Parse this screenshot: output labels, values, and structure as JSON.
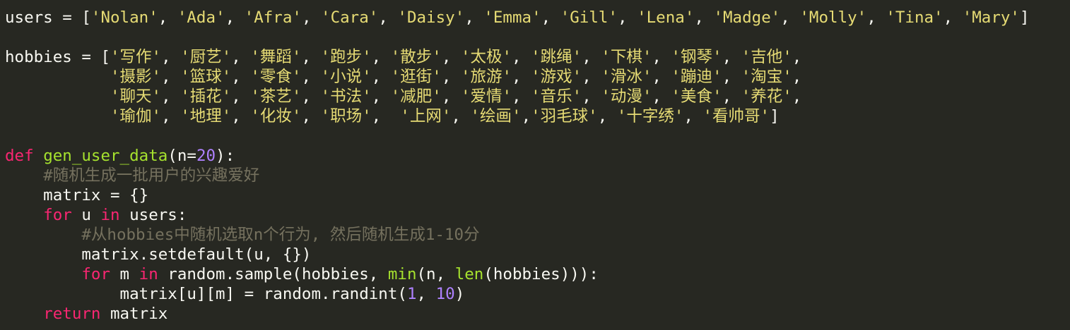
{
  "editor": {
    "theme": {
      "background": "#272822",
      "foreground": "#f8f8f2",
      "keyword": "#f92672",
      "function": "#a6e22e",
      "string": "#e6db74",
      "number": "#ae81ff",
      "comment": "#75715e"
    },
    "code_lines": [
      {
        "tokens": [
          {
            "t": "users = [",
            "c": "pl"
          },
          {
            "t": "'Nolan'",
            "c": "str"
          },
          {
            "t": ", ",
            "c": "pl"
          },
          {
            "t": "'Ada'",
            "c": "str"
          },
          {
            "t": ", ",
            "c": "pl"
          },
          {
            "t": "'Afra'",
            "c": "str"
          },
          {
            "t": ", ",
            "c": "pl"
          },
          {
            "t": "'Cara'",
            "c": "str"
          },
          {
            "t": ", ",
            "c": "pl"
          },
          {
            "t": "'Daisy'",
            "c": "str"
          },
          {
            "t": ", ",
            "c": "pl"
          },
          {
            "t": "'Emma'",
            "c": "str"
          },
          {
            "t": ", ",
            "c": "pl"
          },
          {
            "t": "'Gill'",
            "c": "str"
          },
          {
            "t": ", ",
            "c": "pl"
          },
          {
            "t": "'Lena'",
            "c": "str"
          },
          {
            "t": ", ",
            "c": "pl"
          },
          {
            "t": "'Madge'",
            "c": "str"
          },
          {
            "t": ", ",
            "c": "pl"
          },
          {
            "t": "'Molly'",
            "c": "str"
          },
          {
            "t": ", ",
            "c": "pl"
          },
          {
            "t": "'Tina'",
            "c": "str"
          },
          {
            "t": ", ",
            "c": "pl"
          },
          {
            "t": "'Mary'",
            "c": "str"
          },
          {
            "t": "]",
            "c": "pl"
          }
        ]
      },
      {
        "tokens": []
      },
      {
        "tokens": [
          {
            "t": "hobbies = [",
            "c": "pl"
          },
          {
            "t": "'写作'",
            "c": "str"
          },
          {
            "t": ", ",
            "c": "pl"
          },
          {
            "t": "'厨艺'",
            "c": "str"
          },
          {
            "t": ", ",
            "c": "pl"
          },
          {
            "t": "'舞蹈'",
            "c": "str"
          },
          {
            "t": ", ",
            "c": "pl"
          },
          {
            "t": "'跑步'",
            "c": "str"
          },
          {
            "t": ", ",
            "c": "pl"
          },
          {
            "t": "'散步'",
            "c": "str"
          },
          {
            "t": ", ",
            "c": "pl"
          },
          {
            "t": "'太极'",
            "c": "str"
          },
          {
            "t": ", ",
            "c": "pl"
          },
          {
            "t": "'跳绳'",
            "c": "str"
          },
          {
            "t": ", ",
            "c": "pl"
          },
          {
            "t": "'下棋'",
            "c": "str"
          },
          {
            "t": ", ",
            "c": "pl"
          },
          {
            "t": "'钢琴'",
            "c": "str"
          },
          {
            "t": ", ",
            "c": "pl"
          },
          {
            "t": "'吉他'",
            "c": "str"
          },
          {
            "t": ",",
            "c": "pl"
          }
        ]
      },
      {
        "tokens": [
          {
            "t": "           ",
            "c": "pl"
          },
          {
            "t": "'摄影'",
            "c": "str"
          },
          {
            "t": ", ",
            "c": "pl"
          },
          {
            "t": "'篮球'",
            "c": "str"
          },
          {
            "t": ", ",
            "c": "pl"
          },
          {
            "t": "'零食'",
            "c": "str"
          },
          {
            "t": ", ",
            "c": "pl"
          },
          {
            "t": "'小说'",
            "c": "str"
          },
          {
            "t": ", ",
            "c": "pl"
          },
          {
            "t": "'逛街'",
            "c": "str"
          },
          {
            "t": ", ",
            "c": "pl"
          },
          {
            "t": "'旅游'",
            "c": "str"
          },
          {
            "t": ", ",
            "c": "pl"
          },
          {
            "t": "'游戏'",
            "c": "str"
          },
          {
            "t": ", ",
            "c": "pl"
          },
          {
            "t": "'滑冰'",
            "c": "str"
          },
          {
            "t": ", ",
            "c": "pl"
          },
          {
            "t": "'蹦迪'",
            "c": "str"
          },
          {
            "t": ", ",
            "c": "pl"
          },
          {
            "t": "'淘宝'",
            "c": "str"
          },
          {
            "t": ",",
            "c": "pl"
          }
        ]
      },
      {
        "tokens": [
          {
            "t": "           ",
            "c": "pl"
          },
          {
            "t": "'聊天'",
            "c": "str"
          },
          {
            "t": ", ",
            "c": "pl"
          },
          {
            "t": "'插花'",
            "c": "str"
          },
          {
            "t": ", ",
            "c": "pl"
          },
          {
            "t": "'茶艺'",
            "c": "str"
          },
          {
            "t": ", ",
            "c": "pl"
          },
          {
            "t": "'书法'",
            "c": "str"
          },
          {
            "t": ", ",
            "c": "pl"
          },
          {
            "t": "'减肥'",
            "c": "str"
          },
          {
            "t": ", ",
            "c": "pl"
          },
          {
            "t": "'爱情'",
            "c": "str"
          },
          {
            "t": ", ",
            "c": "pl"
          },
          {
            "t": "'音乐'",
            "c": "str"
          },
          {
            "t": ", ",
            "c": "pl"
          },
          {
            "t": "'动漫'",
            "c": "str"
          },
          {
            "t": ", ",
            "c": "pl"
          },
          {
            "t": "'美食'",
            "c": "str"
          },
          {
            "t": ", ",
            "c": "pl"
          },
          {
            "t": "'养花'",
            "c": "str"
          },
          {
            "t": ",",
            "c": "pl"
          }
        ]
      },
      {
        "tokens": [
          {
            "t": "           ",
            "c": "pl"
          },
          {
            "t": "'瑜伽'",
            "c": "str"
          },
          {
            "t": ", ",
            "c": "pl"
          },
          {
            "t": "'地理'",
            "c": "str"
          },
          {
            "t": ", ",
            "c": "pl"
          },
          {
            "t": "'化妆'",
            "c": "str"
          },
          {
            "t": ", ",
            "c": "pl"
          },
          {
            "t": "'职场'",
            "c": "str"
          },
          {
            "t": ",  ",
            "c": "pl"
          },
          {
            "t": "'上网'",
            "c": "str"
          },
          {
            "t": ", ",
            "c": "pl"
          },
          {
            "t": "'绘画'",
            "c": "str"
          },
          {
            "t": ",",
            "c": "pl"
          },
          {
            "t": "'羽毛球'",
            "c": "str"
          },
          {
            "t": ", ",
            "c": "pl"
          },
          {
            "t": "'十字绣'",
            "c": "str"
          },
          {
            "t": ", ",
            "c": "pl"
          },
          {
            "t": "'看帅哥'",
            "c": "str"
          },
          {
            "t": "]",
            "c": "pl"
          }
        ]
      },
      {
        "tokens": []
      },
      {
        "tokens": [
          {
            "t": "def",
            "c": "kw"
          },
          {
            "t": " ",
            "c": "pl"
          },
          {
            "t": "gen_user_data",
            "c": "fn"
          },
          {
            "t": "(n=",
            "c": "pl"
          },
          {
            "t": "20",
            "c": "num"
          },
          {
            "t": "):",
            "c": "pl"
          }
        ]
      },
      {
        "tokens": [
          {
            "t": "    ",
            "c": "pl"
          },
          {
            "t": "#随机生成一批用户的兴趣爱好",
            "c": "cmt"
          }
        ]
      },
      {
        "tokens": [
          {
            "t": "    matrix = {}",
            "c": "pl"
          }
        ]
      },
      {
        "tokens": [
          {
            "t": "    ",
            "c": "pl"
          },
          {
            "t": "for",
            "c": "kw"
          },
          {
            "t": " u ",
            "c": "pl"
          },
          {
            "t": "in",
            "c": "kw"
          },
          {
            "t": " users:",
            "c": "pl"
          }
        ]
      },
      {
        "tokens": [
          {
            "t": "        ",
            "c": "pl"
          },
          {
            "t": "#从hobbies中随机选取n个行为, 然后随机生成1-10分",
            "c": "cmt"
          }
        ]
      },
      {
        "tokens": [
          {
            "t": "        matrix.setdefault(u, {})",
            "c": "pl"
          }
        ]
      },
      {
        "tokens": [
          {
            "t": "        ",
            "c": "pl"
          },
          {
            "t": "for",
            "c": "kw"
          },
          {
            "t": " m ",
            "c": "pl"
          },
          {
            "t": "in",
            "c": "kw"
          },
          {
            "t": " random.sample(hobbies, ",
            "c": "pl"
          },
          {
            "t": "min",
            "c": "bi"
          },
          {
            "t": "(n, ",
            "c": "pl"
          },
          {
            "t": "len",
            "c": "bi"
          },
          {
            "t": "(hobbies))):",
            "c": "pl"
          }
        ]
      },
      {
        "tokens": [
          {
            "t": "            matrix[u][m] = random.randint(",
            "c": "pl"
          },
          {
            "t": "1",
            "c": "num"
          },
          {
            "t": ", ",
            "c": "pl"
          },
          {
            "t": "10",
            "c": "num"
          },
          {
            "t": ")",
            "c": "pl"
          }
        ]
      },
      {
        "tokens": [
          {
            "t": "    ",
            "c": "pl"
          },
          {
            "t": "return",
            "c": "kw"
          },
          {
            "t": " matrix",
            "c": "pl"
          }
        ]
      }
    ]
  }
}
